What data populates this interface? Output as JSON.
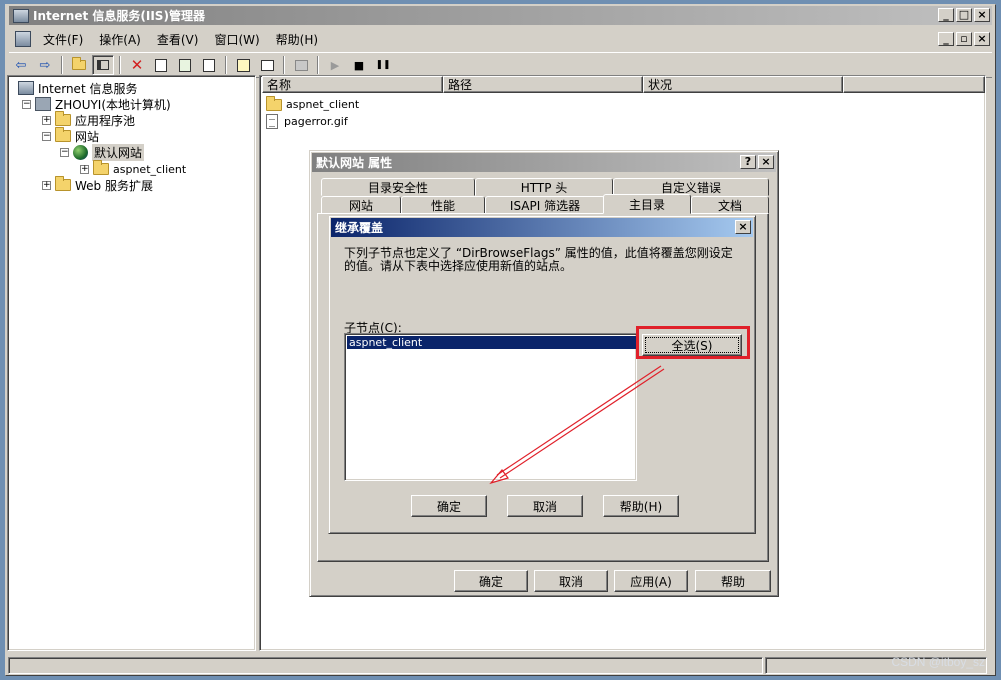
{
  "app": {
    "title": "Internet 信息服务(IIS)管理器",
    "caption_buttons": [
      "_",
      "□",
      "×"
    ],
    "mdi_buttons": [
      "_",
      "▫",
      "×"
    ]
  },
  "menu": {
    "items": [
      "文件(F)",
      "操作(A)",
      "查看(V)",
      "窗口(W)",
      "帮助(H)"
    ]
  },
  "toolbar": {
    "icons": [
      "back-icon",
      "forward-icon",
      "up-folder-icon",
      "show-tree-icon",
      "delete-icon",
      "properties-icon",
      "refresh-icon",
      "export-icon",
      "help-icon",
      "console-icon",
      "computer-icon",
      "start-icon",
      "stop-icon",
      "pause-icon"
    ],
    "glyphs": {
      "back": "⇦",
      "forward": "⇨",
      "delete": "✕",
      "start": "▶",
      "stop": "■",
      "pause": "❚❚"
    }
  },
  "tree": {
    "root": "Internet 信息服务",
    "server": "ZHOUYI(本地计算机)",
    "app_pools": "应用程序池",
    "sites": "网站",
    "default_site": "默认网站",
    "aspnet_client": "aspnet_client",
    "web_ext": "Web 服务扩展",
    "expander_plus": "+",
    "expander_minus": "−"
  },
  "list": {
    "columns": [
      "名称",
      "路径",
      "状况"
    ],
    "items": [
      {
        "name": "aspnet_client",
        "type": "folder"
      },
      {
        "name": "pagerror.gif",
        "type": "file"
      }
    ]
  },
  "props": {
    "title": "默认网站 属性",
    "help_btn": "?",
    "close_btn": "×",
    "tabs_back": [
      "目录安全性",
      "HTTP 头",
      "自定义错误"
    ],
    "tabs_front": [
      "网站",
      "性能",
      "ISAPI 筛选器",
      "主目录",
      "文档"
    ],
    "selected_tab": "主目录",
    "buttons": {
      "ok": "确定",
      "cancel": "取消",
      "apply": "应用(A)",
      "help": "帮助"
    }
  },
  "inherit": {
    "title": "继承覆盖",
    "close_btn": "×",
    "message": "下列子节点也定义了 “DirBrowseFlags” 属性的值，此值将覆盖您刚设定的值。请从下表中选择应使用新值的站点。",
    "children_label": "子节点(C):",
    "children": [
      "aspnet_client"
    ],
    "select_all": "全选(S)",
    "buttons": {
      "ok": "确定",
      "cancel": "取消",
      "help": "帮助(H)"
    }
  },
  "colors": {
    "annotation": "#e0202a",
    "selection": "#0a246a",
    "face": "#d4d0c8"
  },
  "watermark": "CSDN @itboy_sz"
}
